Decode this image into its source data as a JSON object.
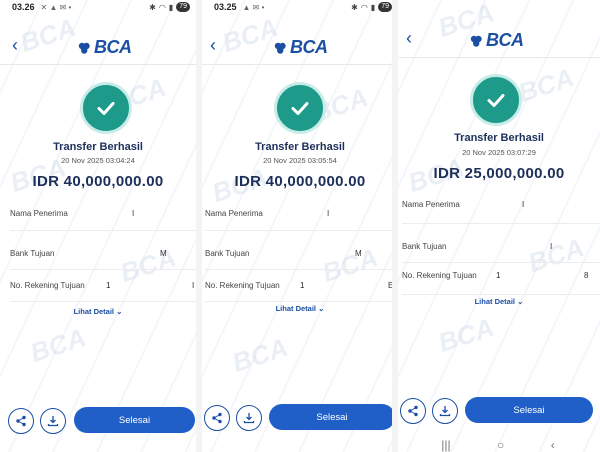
{
  "panels": [
    {
      "status_time": "03.26",
      "battery": "79",
      "logo_text": "BCA",
      "title": "Transfer Berhasil",
      "date": "20 Nov 2025 03:04:24",
      "amount": "IDR 40,000,000.00",
      "rows": [
        {
          "label": "Nama Penerima",
          "value": "",
          "mark": "I"
        },
        {
          "label": "Bank Tujuan",
          "value": "",
          "mark": "M"
        },
        {
          "label": "No. Rekening Tujuan",
          "value": "1",
          "mark": "I"
        }
      ],
      "detail_link": "Lihat Detail",
      "button_label": "Selesai"
    },
    {
      "status_time": "03.25",
      "battery": "79",
      "logo_text": "BCA",
      "title": "Transfer Berhasil",
      "date": "20 Nov 2025 03:05:54",
      "amount": "IDR 40,000,000.00",
      "rows": [
        {
          "label": "Nama Penerima",
          "value": "",
          "mark": "I"
        },
        {
          "label": "Bank Tujuan",
          "value": "",
          "mark": "M"
        },
        {
          "label": "No. Rekening Tujuan",
          "value": "1",
          "mark": "E"
        }
      ],
      "detail_link": "Lihat Detail",
      "button_label": "Selesai"
    },
    {
      "status_time": "",
      "battery": "",
      "logo_text": "BCA",
      "title": "Transfer Berhasil",
      "date": "20 Nov 2025 03:07:29",
      "amount": "IDR 25,000,000.00",
      "rows": [
        {
          "label": "Nama Penerima",
          "value": "",
          "mark": "I"
        },
        {
          "label": "Bank Tujuan",
          "value": "",
          "mark": "I"
        },
        {
          "label": "No. Rekening Tujuan",
          "value": "1",
          "mark": "8"
        }
      ],
      "detail_link": "Lihat Detail",
      "button_label": "Selesai"
    }
  ],
  "watermark": "BCA",
  "colors": {
    "brand": "#1a4fa3",
    "success": "#1e9a8a",
    "button": "#1f5fc7"
  }
}
